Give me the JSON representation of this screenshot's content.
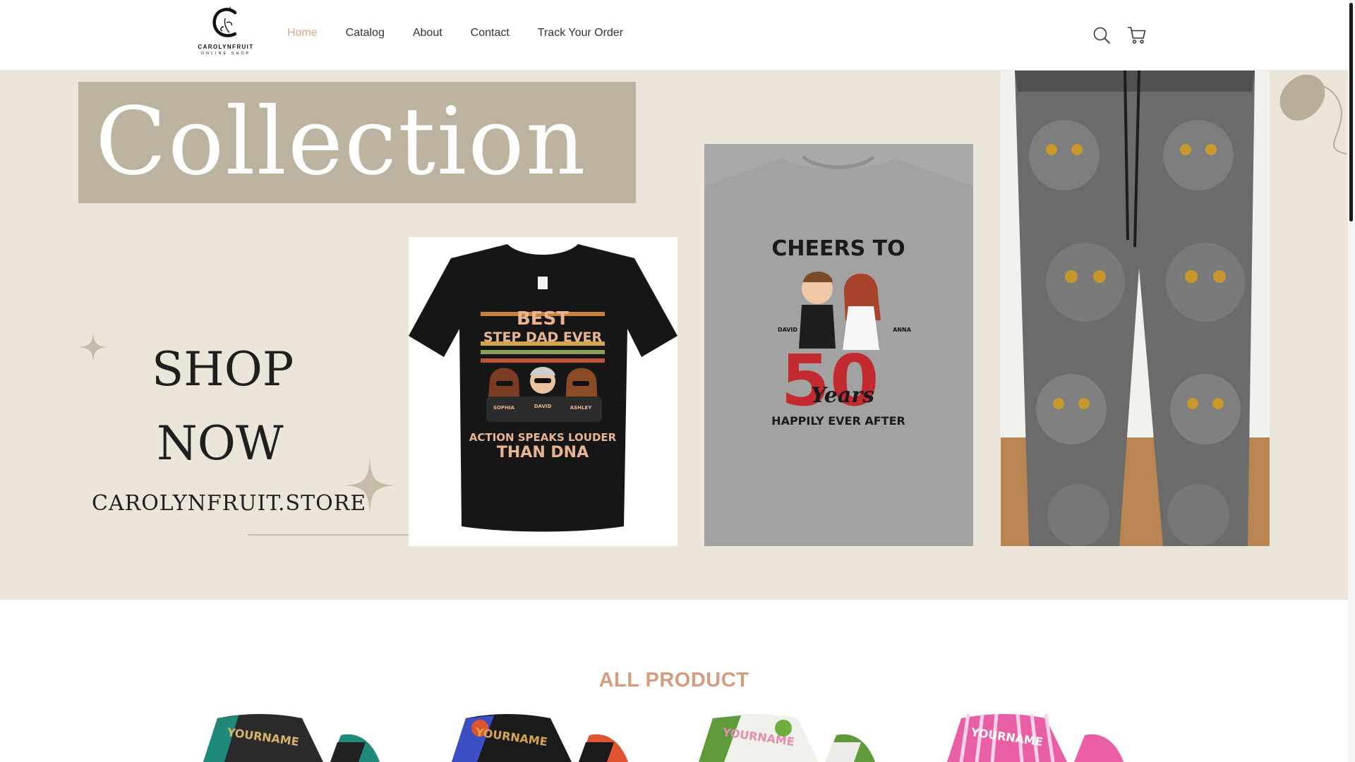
{
  "brand": {
    "name": "CAROLYNFRUIT",
    "tagline": "ONLINE SHOP"
  },
  "nav": {
    "items": [
      "Home",
      "Catalog",
      "About",
      "Contact",
      "Track Your Order"
    ],
    "active": "Home"
  },
  "header_icons": {
    "search": "search-icon",
    "cart": "cart-icon"
  },
  "hero": {
    "heading": "Collection",
    "cta_line1": "SHOP",
    "cta_line2": "NOW",
    "store_url": "CAROLYNFRUIT.STORE",
    "shirt_1": {
      "line1": "BEST",
      "line2": "STEP DAD EVER",
      "names": [
        "SOPHIA",
        "DAVID",
        "ASHLEY"
      ],
      "line3": "ACTION SPEAKS LOUDER",
      "line4": "THAN DNA"
    },
    "shirt_2": {
      "line1": "CHEERS TO",
      "number": "50",
      "word": "Years",
      "line2": "HAPPILY EVER AFTER",
      "names": [
        "DAVID",
        "ANNA"
      ]
    }
  },
  "products_section": {
    "title": "ALL PRODUCT",
    "thumb_text": [
      "YOURNAME",
      "YOURNAME",
      "YOURNAME",
      "YOURNAME"
    ]
  },
  "colors": {
    "accent": "#d9a88a",
    "section_title": "#d59c7f",
    "hero_bg": "#ebe5da",
    "collection_box": "#bcb2a0"
  }
}
